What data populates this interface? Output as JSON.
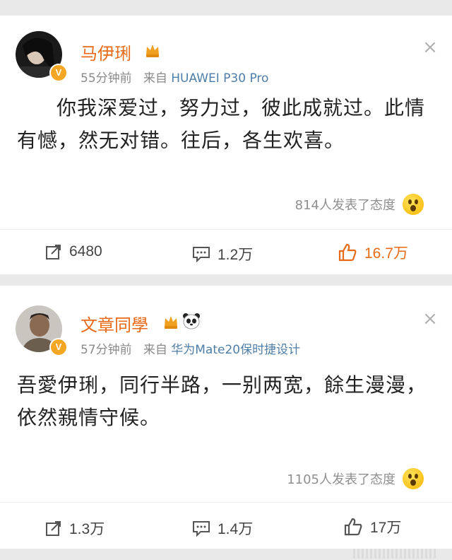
{
  "posts": [
    {
      "name": "马伊琍",
      "time": "55分钟前",
      "from": "来自",
      "source": "HUAWEI P30 Pro",
      "text": "你我深爱过，努力过，彼此成就过。此情有憾，然无对错。往后，各生欢喜。",
      "reactions": "814人发表了态度",
      "repost": "6480",
      "comment": "1.2万",
      "like": "16.7万",
      "liked": true
    },
    {
      "name": "文章同學",
      "time": "57分钟前",
      "from": "来自",
      "source": "华为Mate20保时捷设计",
      "text": "吾愛伊琍，同行半路，一别两宽，餘生漫漫，依然親情守候。",
      "reactions": "1105人发表了态度",
      "repost": "1.3万",
      "comment": "1.4万",
      "like": "17万",
      "liked": false
    }
  ],
  "colors": {
    "name": "#e86a17",
    "source": "#4e7ea8",
    "meta": "#8a8a8a",
    "liked": "#e86a17",
    "background": "#e9e9e9"
  },
  "icons": [
    "verified-badge-icon",
    "vip-icon",
    "panda-icon",
    "close-icon",
    "wow-emoji-icon",
    "repost-icon",
    "comment-icon",
    "like-icon"
  ]
}
